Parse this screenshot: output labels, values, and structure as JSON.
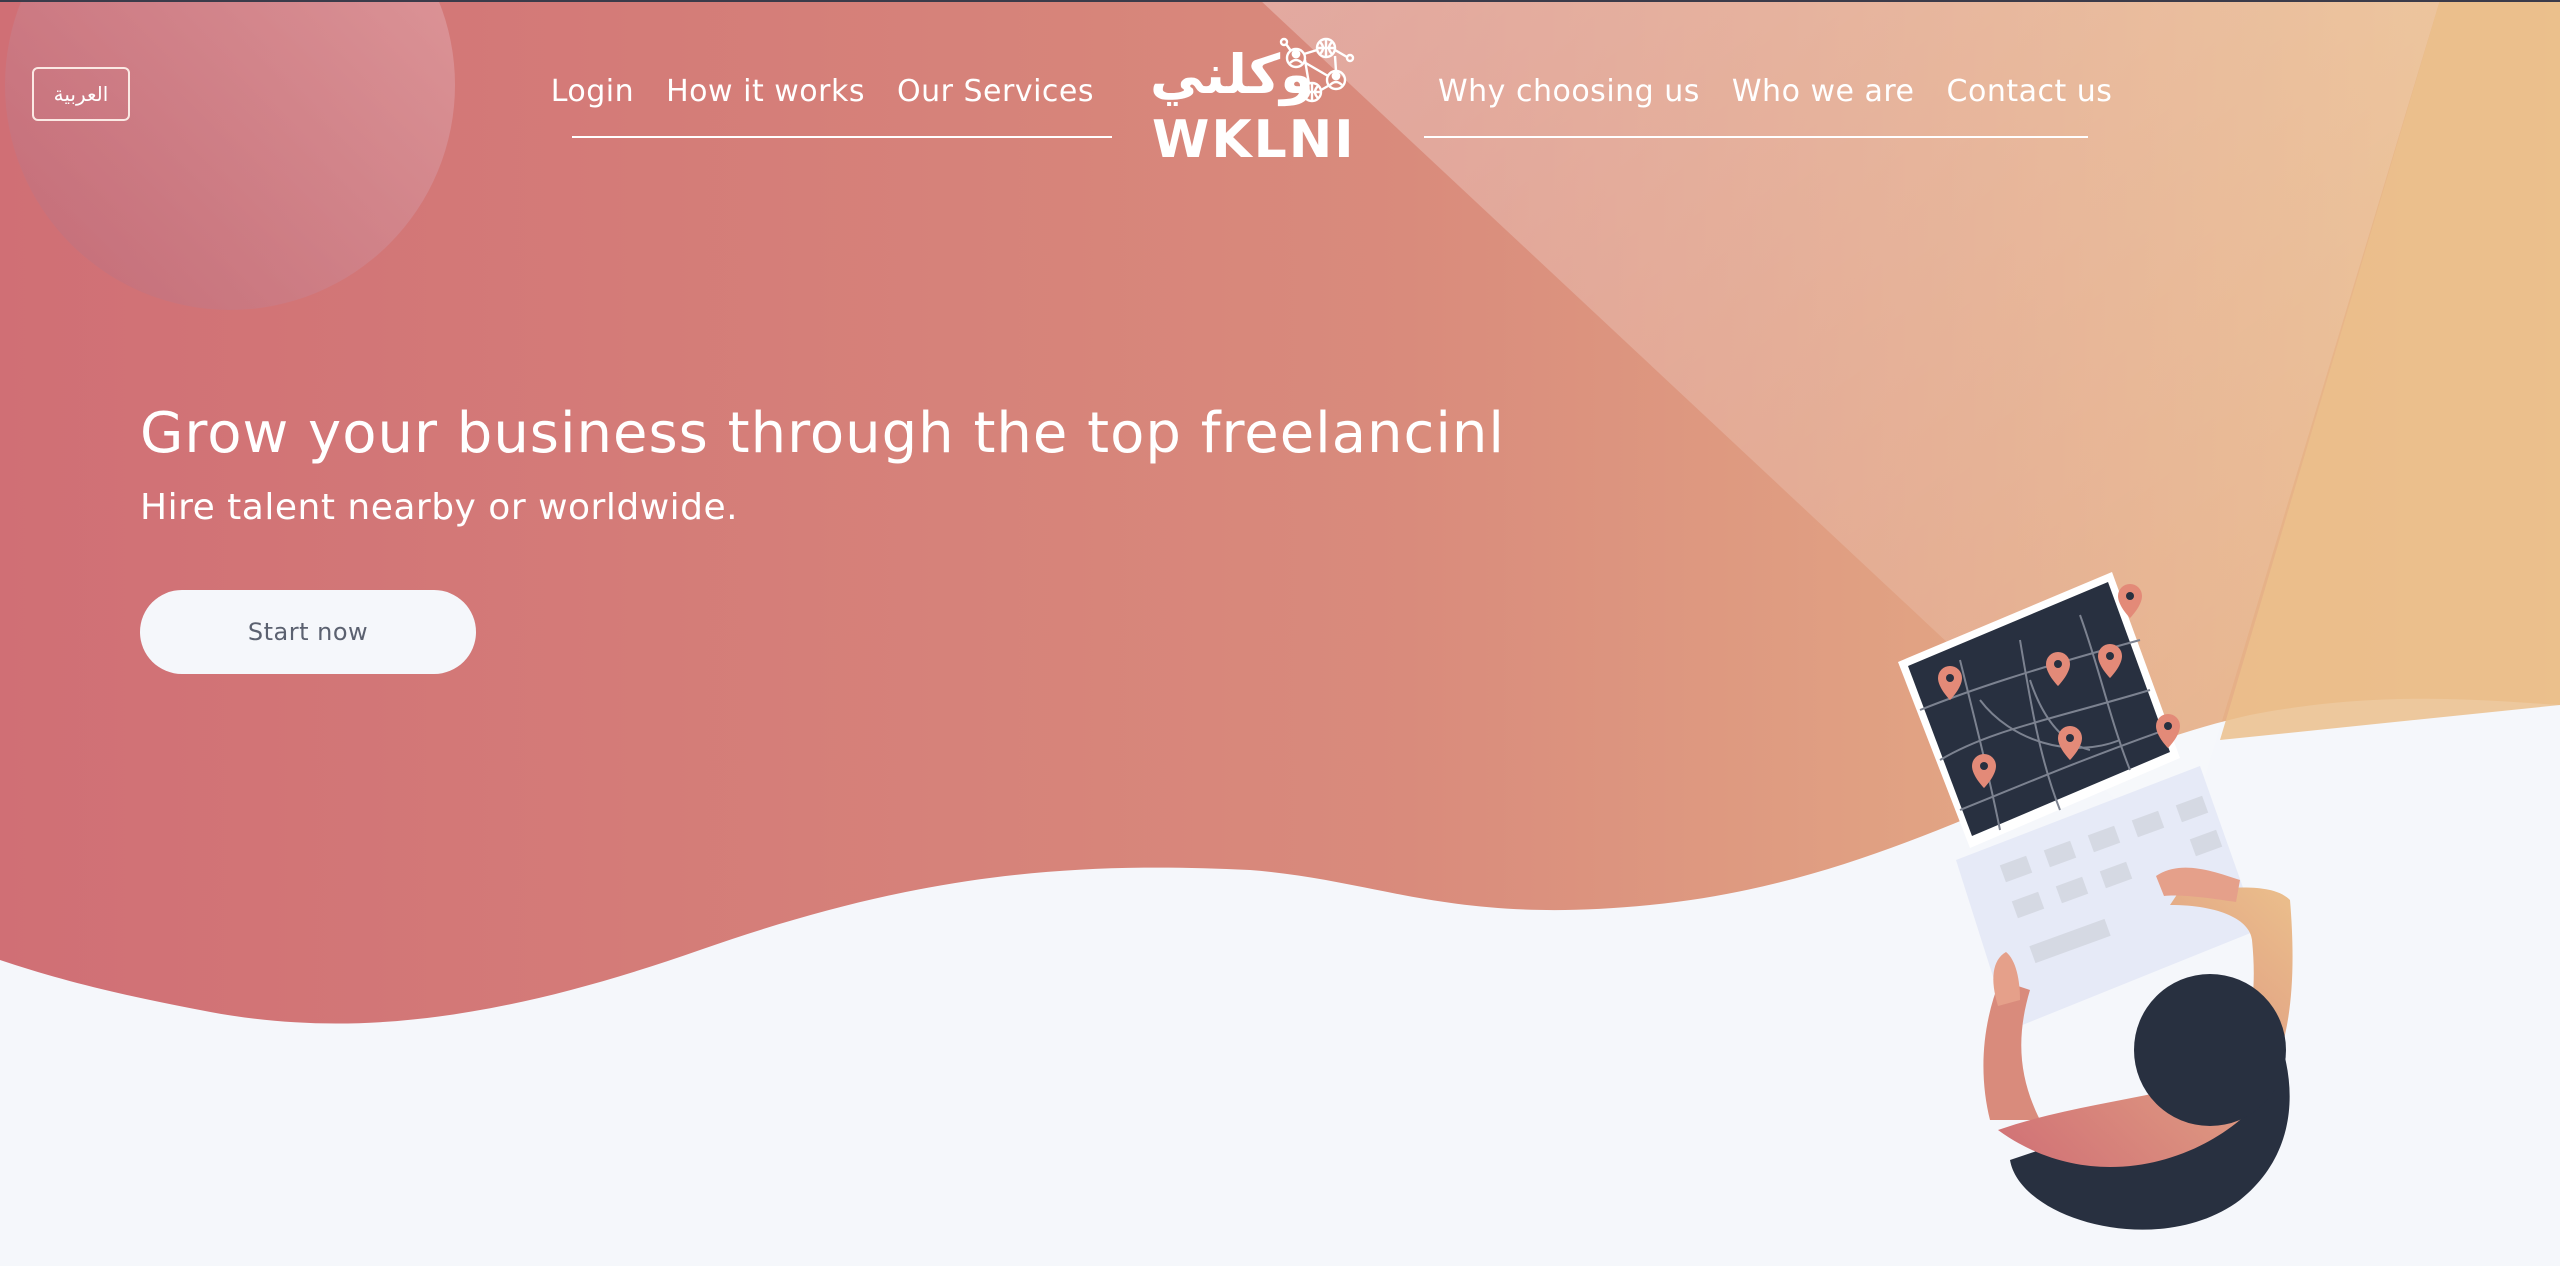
{
  "language_toggle": {
    "label": "العربية"
  },
  "nav": {
    "left_items": [
      {
        "label": "Login"
      },
      {
        "label": "How it works"
      },
      {
        "label": "Our Services"
      }
    ],
    "right_items": [
      {
        "label": "Why choosing us"
      },
      {
        "label": "Who we are"
      },
      {
        "label": "Contact us"
      }
    ]
  },
  "logo": {
    "arabic": "وكلني",
    "latin": "WKLNI"
  },
  "hero": {
    "title": "Grow your business through the top freelancinl",
    "subtitle": "Hire talent nearby or worldwide.",
    "cta_label": "Start now"
  },
  "icons": [
    "network-people-icon",
    "map-pin-icon"
  ],
  "colors": {
    "gradient_start": "#d06f75",
    "gradient_mid": "#d98b7c",
    "gradient_end": "#ebbf8c",
    "page_background": "#f5f7fb",
    "dark": "#283040"
  }
}
